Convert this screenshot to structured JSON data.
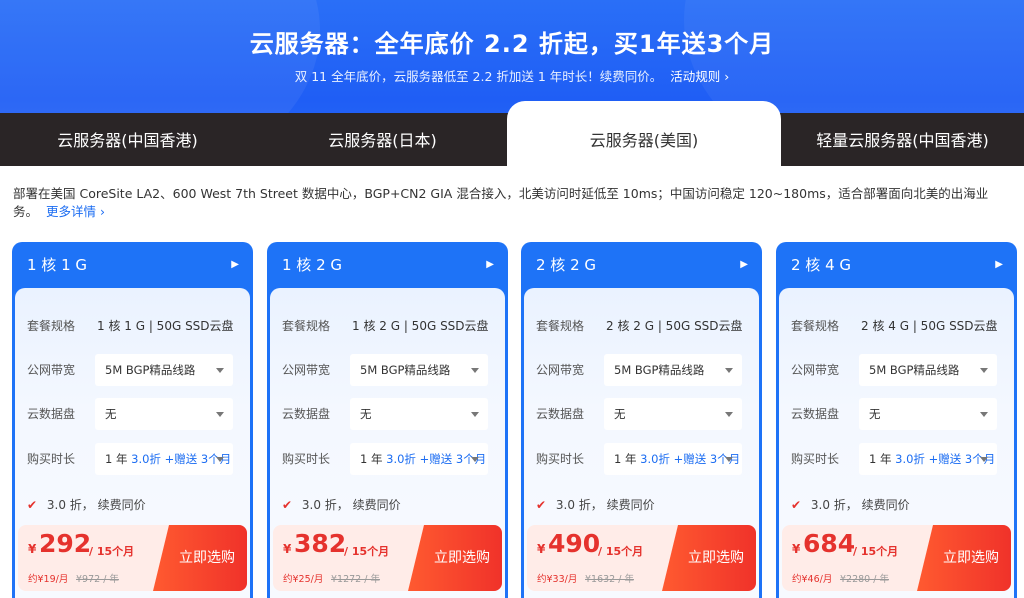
{
  "banner": {
    "headline": "云服务器：全年底价 2.2 折起，买1年送3个月",
    "subline": "双 11 全年底价，云服务器低至 2.2 折加送 1 年时长！续费同价。",
    "rule_link": "活动规则 ›"
  },
  "tabs": [
    {
      "label": "云服务器(中国香港)",
      "active": false
    },
    {
      "label": "云服务器(日本)",
      "active": false
    },
    {
      "label": "云服务器(美国)",
      "active": true
    },
    {
      "label": "轻量云服务器(中国香港)",
      "active": false
    }
  ],
  "description": {
    "text": "部署在美国 CoreSite LA2、600 West 7th Street 数据中心，BGP+CN2 GIA 混合接入，北美访问时延低至 10ms；中国访问稳定 120~180ms，适合部署面向北美的出海业务。",
    "more": "更多详情 ›"
  },
  "labels": {
    "spec": "套餐规格",
    "bandwidth": "公网带宽",
    "disk": "云数据盘",
    "duration": "购买时长",
    "discount_note": "3.0 折，  续费同价",
    "per_period": "/ 15个月",
    "buy": "立即选购",
    "currency": "¥"
  },
  "cards": [
    {
      "title": "1 核 1 G",
      "spec": "1 核 1 G | 50G SSD云盘",
      "bandwidth": "5M BGP精品线路",
      "disk": "无",
      "duration_year": "1 年",
      "duration_discount": "3.0折",
      "duration_bonus": "+赠送 3个月",
      "price": "292",
      "monthly": "约¥19/月",
      "original": "¥972 / 年"
    },
    {
      "title": "1 核 2 G",
      "spec": "1 核 2 G | 50G SSD云盘",
      "bandwidth": "5M BGP精品线路",
      "disk": "无",
      "duration_year": "1 年",
      "duration_discount": "3.0折",
      "duration_bonus": "+赠送 3个月",
      "price": "382",
      "monthly": "约¥25/月",
      "original": "¥1272 / 年"
    },
    {
      "title": "2 核 2 G",
      "spec": "2 核 2 G | 50G SSD云盘",
      "bandwidth": "5M BGP精品线路",
      "disk": "无",
      "duration_year": "1 年",
      "duration_discount": "3.0折",
      "duration_bonus": "+赠送 3个月",
      "price": "490",
      "monthly": "约¥33/月",
      "original": "¥1632 / 年"
    },
    {
      "title": "2 核 4 G",
      "spec": "2 核 4 G | 50G SSD云盘",
      "bandwidth": "5M BGP精品线路",
      "disk": "无",
      "duration_year": "1 年",
      "duration_discount": "3.0折",
      "duration_bonus": "+赠送 3个月",
      "price": "684",
      "monthly": "约¥46/月",
      "original": "¥2280 / 年"
    }
  ],
  "colors": {
    "banner_blue": "#2a6ff7",
    "tab_bar": "#2a2526",
    "card_blue": "#1e73f7",
    "price_red": "#e5322d",
    "link_blue": "#1c6df2"
  }
}
